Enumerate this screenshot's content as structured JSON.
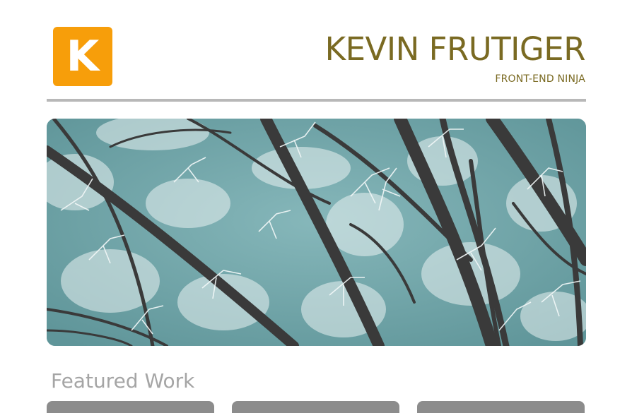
{
  "header": {
    "logo_letter": "K",
    "site_title": "KEVIN FRUTIGER",
    "tagline": "FRONT-END NINJA"
  },
  "colors": {
    "brand_orange": "#f79e0a",
    "title_olive": "#7a6a22",
    "rule_gray": "#b8b8b8",
    "sky_teal": "#6fa3a7",
    "heading_gray": "#a5a5a5",
    "card_gray": "#8c8c8c"
  },
  "hero": {
    "image_subject": "frost-covered-tree-branches"
  },
  "featured": {
    "heading": "Featured Work",
    "cards": [
      {
        "name": "card-1"
      },
      {
        "name": "card-2"
      },
      {
        "name": "card-3"
      }
    ]
  }
}
